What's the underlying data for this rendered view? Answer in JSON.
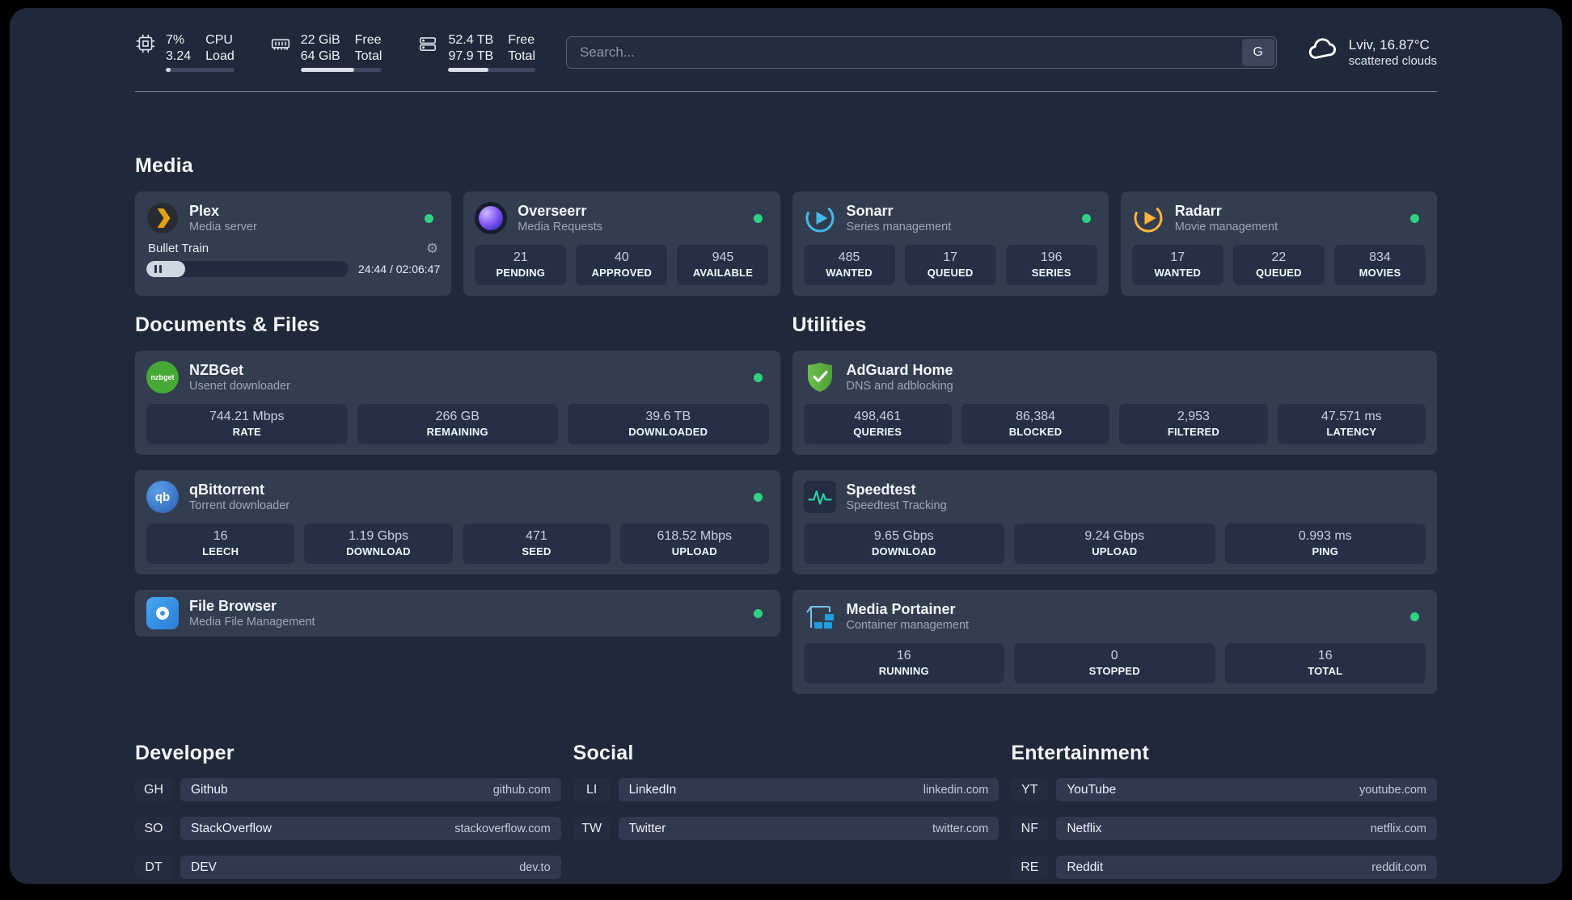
{
  "colors": {
    "page_bg": "#1f2939",
    "card_bg": "#333d50",
    "stat_bg": "#253046",
    "online_dot": "#2fd182"
  },
  "topbar": {
    "cpu": {
      "icon": "cpu-icon",
      "value_top": "7%",
      "value_bottom": "3.24",
      "label_top": "CPU",
      "label_bottom": "Load",
      "progress_pct": 7
    },
    "memory": {
      "icon": "memory-icon",
      "value_top": "22 GiB",
      "value_bottom": "64 GiB",
      "label_top": "Free",
      "label_bottom": "Total",
      "progress_pct": 66
    },
    "disk": {
      "icon": "disk-icon",
      "value_top": "52.4 TB",
      "value_bottom": "97.9 TB",
      "label_top": "Free",
      "label_bottom": "Total",
      "progress_pct": 46
    },
    "search": {
      "placeholder": "Search...",
      "provider_label": "G"
    },
    "weather": {
      "icon": "cloud-icon",
      "location": "Lviv, 16.87°C",
      "condition": "scattered clouds"
    }
  },
  "sections": {
    "media": {
      "title": "Media",
      "plex": {
        "icon": "plex-icon",
        "name": "Plex",
        "desc": "Media server",
        "now_playing": "Bullet Train",
        "time": "24:44 / 02:06:47",
        "progress_pct": 19
      },
      "overseerr": {
        "icon": "overseerr-icon",
        "name": "Overseerr",
        "desc": "Media Requests",
        "stats": [
          {
            "value": "21",
            "label": "PENDING"
          },
          {
            "value": "40",
            "label": "APPROVED"
          },
          {
            "value": "945",
            "label": "AVAILABLE"
          }
        ]
      },
      "sonarr": {
        "icon": "sonarr-icon",
        "name": "Sonarr",
        "desc": "Series management",
        "stats": [
          {
            "value": "485",
            "label": "WANTED"
          },
          {
            "value": "17",
            "label": "QUEUED"
          },
          {
            "value": "196",
            "label": "SERIES"
          }
        ]
      },
      "radarr": {
        "icon": "radarr-icon",
        "name": "Radarr",
        "desc": "Movie management",
        "stats": [
          {
            "value": "17",
            "label": "WANTED"
          },
          {
            "value": "22",
            "label": "QUEUED"
          },
          {
            "value": "834",
            "label": "MOVIES"
          }
        ]
      }
    },
    "documents": {
      "title": "Documents & Files",
      "nzbget": {
        "icon": "nzbget-icon",
        "icon_label": "nzbget",
        "name": "NZBGet",
        "desc": "Usenet downloader",
        "stats": [
          {
            "value": "744.21 Mbps",
            "label": "RATE"
          },
          {
            "value": "266 GB",
            "label": "REMAINING"
          },
          {
            "value": "39.6 TB",
            "label": "DOWNLOADED"
          }
        ]
      },
      "qbittorrent": {
        "icon": "qbittorrent-icon",
        "icon_label": "qb",
        "name": "qBittorrent",
        "desc": "Torrent downloader",
        "stats": [
          {
            "value": "16",
            "label": "LEECH"
          },
          {
            "value": "1.19 Gbps",
            "label": "DOWNLOAD"
          },
          {
            "value": "471",
            "label": "SEED"
          },
          {
            "value": "618.52 Mbps",
            "label": "UPLOAD"
          }
        ]
      },
      "filebrowser": {
        "icon": "filebrowser-icon",
        "name": "File Browser",
        "desc": "Media File Management"
      }
    },
    "utilities": {
      "title": "Utilities",
      "adguard": {
        "icon": "adguard-icon",
        "name": "AdGuard Home",
        "desc": "DNS and adblocking",
        "stats": [
          {
            "value": "498,461",
            "label": "QUERIES"
          },
          {
            "value": "86,384",
            "label": "BLOCKED"
          },
          {
            "value": "2,953",
            "label": "FILTERED"
          },
          {
            "value": "47.571 ms",
            "label": "LATENCY"
          }
        ]
      },
      "speedtest": {
        "icon": "speedtest-icon",
        "name": "Speedtest",
        "desc": "Speedtest Tracking",
        "stats": [
          {
            "value": "9.65 Gbps",
            "label": "DOWNLOAD"
          },
          {
            "value": "9.24 Gbps",
            "label": "UPLOAD"
          },
          {
            "value": "0.993 ms",
            "label": "PING"
          }
        ]
      },
      "portainer": {
        "icon": "portainer-icon",
        "name": "Media Portainer",
        "desc": "Container management",
        "stats": [
          {
            "value": "16",
            "label": "RUNNING"
          },
          {
            "value": "0",
            "label": "STOPPED"
          },
          {
            "value": "16",
            "label": "TOTAL"
          }
        ]
      }
    }
  },
  "bookmarks": {
    "developer": {
      "title": "Developer",
      "items": [
        {
          "abbr": "GH",
          "name": "Github",
          "domain": "github.com"
        },
        {
          "abbr": "SO",
          "name": "StackOverflow",
          "domain": "stackoverflow.com"
        },
        {
          "abbr": "DT",
          "name": "DEV",
          "domain": "dev.to"
        }
      ]
    },
    "social": {
      "title": "Social",
      "items": [
        {
          "abbr": "LI",
          "name": "LinkedIn",
          "domain": "linkedin.com"
        },
        {
          "abbr": "TW",
          "name": "Twitter",
          "domain": "twitter.com"
        }
      ]
    },
    "entertainment": {
      "title": "Entertainment",
      "items": [
        {
          "abbr": "YT",
          "name": "YouTube",
          "domain": "youtube.com"
        },
        {
          "abbr": "NF",
          "name": "Netflix",
          "domain": "netflix.com"
        },
        {
          "abbr": "RE",
          "name": "Reddit",
          "domain": "reddit.com"
        }
      ]
    }
  }
}
